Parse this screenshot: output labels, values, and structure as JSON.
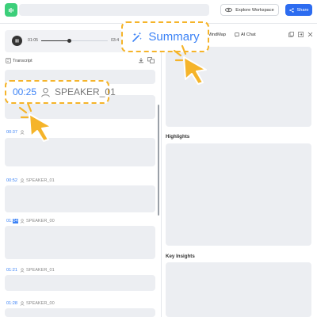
{
  "header": {
    "explore_label": "Explore Workspace",
    "share_label": "Share"
  },
  "player": {
    "current_time": "01:05",
    "total_time": "03:4",
    "progress": 0.42
  },
  "transcript": {
    "title": "Transcript",
    "entries": [
      {
        "time": "00:37",
        "speaker": ""
      },
      {
        "time": "00:52",
        "speaker": "SPEAKER_01"
      },
      {
        "time": "01:",
        "time_highlight": "04",
        "speaker": "SPEAKER_00"
      },
      {
        "time": "01:21",
        "speaker": "SPEAKER_01"
      },
      {
        "time": "01:28",
        "speaker": "SPEAKER_00"
      }
    ],
    "callout": {
      "time": "00:25",
      "speaker": "SPEAKER_01"
    }
  },
  "right_panel": {
    "tabs": {
      "summary": "Summary",
      "mindmap": "MindMap",
      "ai_chat": "AI Chat"
    },
    "highlights_title": "Highlights",
    "key_insights_title": "Key Insights"
  },
  "colors": {
    "accent": "#3b82f6",
    "share_button": "#2d6cf0",
    "callout_border": "#f5b42a",
    "placeholder": "#eceef2"
  },
  "icons": [
    "app-icon",
    "explore-icon",
    "share-icon",
    "pause-icon",
    "transcript-icon",
    "download-icon",
    "translate-icon",
    "speaker-icon",
    "sparkle-wand-icon",
    "ai-chat-icon",
    "copy-icon",
    "export-icon",
    "close-icon",
    "cursor-hand-icon"
  ]
}
